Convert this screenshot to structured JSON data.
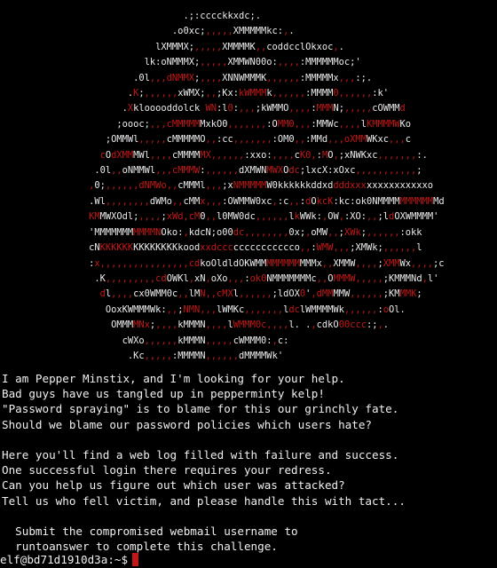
{
  "terminal": {
    "ascii_art": [
      "                                 .;:cccckkxdc;.",
      "                               .o0xc;,,,,,XMMMMMkc:,.",
      "                            lXMMMX;,,,,,XMMMMK,,coddcclOkxoc,.",
      "                          lk:oNMMMX;,,,,,XMMWN00o:,,,,:MMMMMMoc;'",
      "                        .0l,,,dNMMX;,,,,XNNWMMMK,,,,,,:MMMMMx,,,:;.",
      "                       .K;,,,,,,xWMX;,,;Kx:kWMMMk,,,,,,:MMMM0,,,,,,:k'",
      "                      .Xklooooddolck WN:l0:,,,;kWMMO,,,,:MMMN;,,,,,cOWMMd",
      "                     ;oooc;,,,cMMMMMMxkO0,,,,,,,:OMM0,,,:MMWc,,,,lKMMMMWKo",
      "                   ;OMMWl,,,,,cMMMMMO,,:cc,,,,,,,:OM0,,:MMd,,,oXMMWKxc,,,c",
      "                  cOdXMMMWl,,,,cMMMMMX,,,,,,:xxo:,,,,cK0,:MO,;xNWKxc,,,,,,,:.",
      "                 .0l,,oNMMWl,,,cMMMW:,,,,,,dXMWNMWXOdc;lxcX:xOxc,,,,,,,,,,,;",
      "                ,0;,,,,,,dNMWo,,cMMMl,,,;xNMMMMMW0kkkkkkddxddddxxxxxxxxxxxxxxo",
      "                .Wl,,,,,,,,dWMo,,cMMx,,,:OWMMW0xc,:c,,:dOkcK:kc:ok0NMMMMMMMMMMMd",
      "                KMMWXOdl;,,,,;xWd,cM0,,l0MW0dc,,,,,,lkWWk:,OW,:XO:,,;ldOXWMMMM'",
      "                'MMMMMMMMMMMNOko:,kdcN;o00dc,,,,,,,,0x;,oMW,,;XWk;,,,,,,:okk",
      "                cNKKKKKKKKKKKKKKkoodxxdcccccccccccccco,,:WMW,,,;XMWk;,,,,,,l",
      "                :x,,,,,,,,,,,,,,,,cdkoOldldOKWMMMMMMMMMMMx,,XMMW,,,,;XMMWx,,,,;c",
      "                 .K,,,,,,,,,cdOWKl,xN,oXo,,,:ok0NMMMMMMMc,,OMMMW,,,,,;KMMMNd,l'",
      "                  dl,,,,cx0WMM0c,,lMN,,cMXl,,,,,,;ldOX0',dMMMMW,,,,,,;KMMMK;",
      "                   OoxKWMMMWk:,,;NMN,,,lWMKc,,,,,,,ldclWMMMMWk,,,,,,:oOl.",
      "                    OMMMMNx;,,,,kMMMN,,,,lWMMM0c,,,,l. .,cdkO00ccc:;,.",
      "                      cWXo,,,,,,kMMMN,,,,,cWMMM0:,c:",
      "                       .Kc,,,,,:MMMMN,,,,,,dMMMMWk'"
    ],
    "poem": [
      "I am Pepper Minstix, and I'm looking for your help.",
      "Bad guys have us tangled up in pepperminty kelp!",
      "\"Password spraying\" is to blame for this our grinchly fate.",
      "Should we blame our password policies which users hate?",
      "",
      "Here you'll find a web log filled with failure and success.",
      "One successful login there requires your redress.",
      "Can you help us figure out which user was attacked?",
      "Tell us who fell victim, and please handle this with tact...",
      "",
      "  Submit the compromised webmail username to",
      "  runtoanswer to complete this challenge."
    ],
    "prompt": "elf@bd71d1910d3a:~$",
    "colors": {
      "background": "#000000",
      "text": "#f0f0f0",
      "accent_red": "#c21818"
    }
  }
}
